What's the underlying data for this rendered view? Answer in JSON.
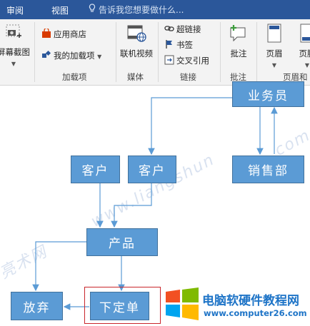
{
  "tabs": [
    "审阅",
    "视图"
  ],
  "tell_me": "告诉我您想要做什么...",
  "ribbon": {
    "screenshot": "屏幕截图",
    "store": "应用商店",
    "my_addins": "我的加载项",
    "addins_group": "加载项",
    "online_video": "联机视频",
    "media_group": "媒体",
    "hyperlink": "超链接",
    "bookmark": "书签",
    "cross_ref": "交叉引用",
    "links_group": "链接",
    "comment": "批注",
    "comments_group": "批注",
    "header": "页眉",
    "footer": "页脚",
    "header_footer_group": "页眉和"
  },
  "diagram": {
    "nodes": {
      "salesperson": "业务员",
      "customer1": "客户",
      "customer2": "客户",
      "sales_dept": "销售部",
      "product": "产品",
      "give_up": "放弃",
      "place_order": "下定单"
    },
    "colors": {
      "node_fill": "#5b9bd5",
      "node_border": "#41719c",
      "connector": "#5b9bd5",
      "highlight": "#c8262b"
    }
  },
  "watermark": {
    "text1": "www.liangshun",
    "text2": "亮术网",
    "text3": ".com"
  },
  "logo": {
    "name": "电脑软硬件教程网",
    "url": "www.computer26.com"
  }
}
